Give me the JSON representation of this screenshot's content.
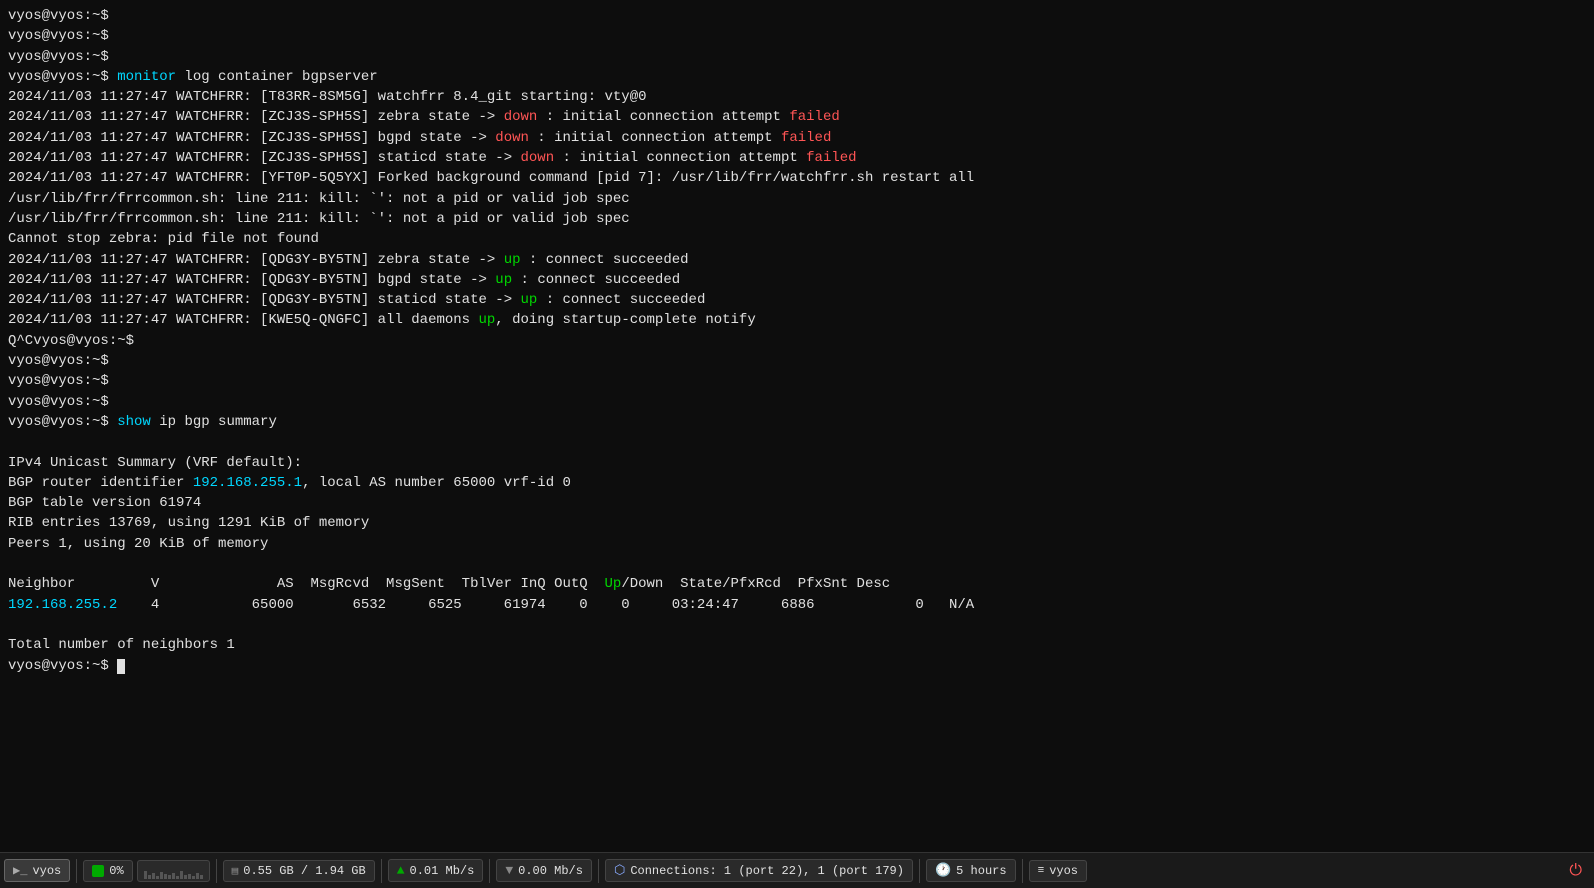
{
  "terminal": {
    "lines": [
      {
        "type": "prompt",
        "text": "vyos@vyos:~$"
      },
      {
        "type": "prompt",
        "text": "vyos@vyos:~$"
      },
      {
        "type": "prompt",
        "text": "vyos@vyos:~$"
      },
      {
        "type": "prompt-cmd",
        "prompt": "vyos@vyos:~$",
        "cmd": "monitor",
        "rest": " log container bgpserver"
      },
      {
        "type": "log",
        "date": "2024/11/03 11:27:47",
        "tag": "WATCHFRR:",
        "bracket": "[T83RR-8SM5G]",
        "msg": " watchfrr 8.4_git starting: vty@0"
      },
      {
        "type": "log-status",
        "date": "2024/11/03 11:27:47",
        "tag": "WATCHFRR:",
        "bracket": "[ZCJ3S-SPH5S]",
        "pre": " zebra state -> ",
        "status": "down",
        "post": " : initial connection attempt ",
        "result": "failed"
      },
      {
        "type": "log-status",
        "date": "2024/11/03 11:27:47",
        "tag": "WATCHFRR:",
        "bracket": "[ZCJ3S-SPH5S]",
        "pre": " bgpd state -> ",
        "status": "down",
        "post": " : initial connection attempt ",
        "result": "failed"
      },
      {
        "type": "log-status",
        "date": "2024/11/03 11:27:47",
        "tag": "WATCHFRR:",
        "bracket": "[ZCJ3S-SPH5S]",
        "pre": " staticd state -> ",
        "status": "down",
        "post": " : initial connection attempt ",
        "result": "failed"
      },
      {
        "type": "log",
        "date": "2024/11/03 11:27:47",
        "tag": "WATCHFRR:",
        "bracket": "[YFT0P-5Q5YX]",
        "msg": " Forked background command [pid 7]: /usr/lib/frr/watchfrr.sh restart all"
      },
      {
        "type": "plain",
        "text": "/usr/lib/frr/frrcommon.sh: line 211: kill: `': not a pid or valid job spec"
      },
      {
        "type": "plain",
        "text": "/usr/lib/frr/frrcommon.sh: line 211: kill: `': not a pid or valid job spec"
      },
      {
        "type": "plain",
        "text": "Cannot stop zebra: pid file not found"
      },
      {
        "type": "log-status2",
        "date": "2024/11/03 11:27:47",
        "tag": "WATCHFRR:",
        "bracket": "[QDG3Y-BY5TN]",
        "pre": " zebra state -> ",
        "status": "up",
        "post": " : connect succeeded"
      },
      {
        "type": "log-status2",
        "date": "2024/11/03 11:27:47",
        "tag": "WATCHFRR:",
        "bracket": "[QDG3Y-BY5TN]",
        "pre": " bgpd state -> ",
        "status": "up",
        "post": " : connect succeeded"
      },
      {
        "type": "log-status2",
        "date": "2024/11/03 11:27:47",
        "tag": "WATCHFRR:",
        "bracket": "[QDG3Y-BY5TN]",
        "pre": " staticd state -> ",
        "status": "up",
        "post": " : connect succeeded"
      },
      {
        "type": "log-all-up",
        "date": "2024/11/03 11:27:47",
        "tag": "WATCHFRR:",
        "bracket": "[KWE5Q-QNGFC]",
        "pre": " all daemons ",
        "status": "up",
        "post": ", doing startup-complete notify"
      },
      {
        "type": "qc-prompt",
        "text": "Q^Cvyos@vyos:~$"
      },
      {
        "type": "prompt",
        "text": "vyos@vyos:~$"
      },
      {
        "type": "prompt",
        "text": "vyos@vyos:~$"
      },
      {
        "type": "prompt",
        "text": "vyos@vyos:~$"
      },
      {
        "type": "prompt-cmd2",
        "prompt": "vyos@vyos:~$",
        "cmd": "show",
        "cmd2": " ip",
        "rest": " bgp summary"
      },
      {
        "type": "blank"
      },
      {
        "type": "plain",
        "text": "IPv4 Unicast Summary (VRF default):"
      },
      {
        "type": "bgp-router",
        "pre": "BGP router identifier ",
        "ip": "192.168.255.1",
        "post": ", local AS number 65000 vrf-id 0"
      },
      {
        "type": "plain",
        "text": "BGP table version 61974"
      },
      {
        "type": "plain",
        "text": "RIB entries 13769, using 1291 KiB of memory"
      },
      {
        "type": "plain",
        "text": "Peers 1, using 20 KiB of memory"
      },
      {
        "type": "blank"
      },
      {
        "type": "table-header",
        "cols": [
          "Neighbor",
          "V",
          "AS",
          "MsgRcvd",
          "MsgSent",
          "TblVer",
          "InQ",
          "OutQ",
          "Up/Down",
          "State/PfxRcd",
          "PfxSnt",
          "Desc"
        ]
      },
      {
        "type": "table-row",
        "neighbor": "192.168.255.2",
        "v": "4",
        "as": "65000",
        "msgrcvd": "6532",
        "msgsent": "6525",
        "tblver": "61974",
        "inq": "0",
        "outq": "0",
        "updown": "03:24:47",
        "state": "6886",
        "pfxsnt": "0",
        "desc": "N/A"
      },
      {
        "type": "blank"
      },
      {
        "type": "plain",
        "text": "Total number of neighbors 1"
      },
      {
        "type": "prompt-cursor",
        "text": "vyos@vyos:~$"
      }
    ]
  },
  "taskbar": {
    "items": [
      {
        "id": "terminal",
        "icon": "terminal",
        "label": "vyos",
        "active": true
      },
      {
        "id": "cpu",
        "icon": "green-square",
        "label": "0%",
        "active": false
      },
      {
        "id": "cpu-bar",
        "icon": "bar",
        "label": "",
        "active": false
      },
      {
        "id": "memory",
        "icon": "memory",
        "label": "0.55 GB / 1.94 GB",
        "active": false
      },
      {
        "id": "upload",
        "icon": "upload",
        "label": "0.01 Mb/s",
        "active": false
      },
      {
        "id": "download",
        "icon": "download",
        "label": "0.00 Mb/s",
        "active": false
      },
      {
        "id": "connections",
        "icon": "connection",
        "label": "Connections: 1 (port 22), 1 (port 179)",
        "active": false
      },
      {
        "id": "uptime",
        "icon": "clock",
        "label": "5 hours",
        "active": false
      },
      {
        "id": "hostname",
        "icon": "vyos",
        "label": "vyos",
        "active": false
      }
    ],
    "power_label": "⏻"
  }
}
